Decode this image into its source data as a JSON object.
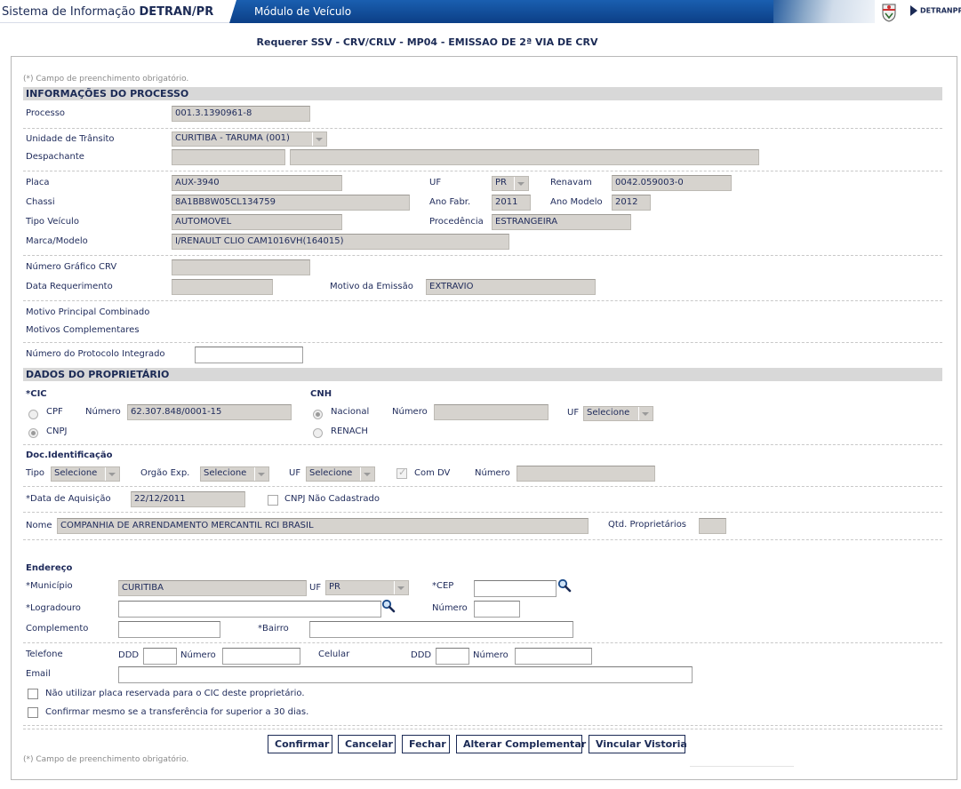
{
  "header": {
    "system_title_prefix": "Sistema de Informação",
    "system_title_brand": "DETRAN/PR",
    "module_title": "Módulo de Veículo",
    "logo_text": "DETRANPR"
  },
  "page_title": "Requerer SSV - CRV/CRLV - MP04 - EMISSAO DE 2ª VIA DE CRV",
  "required_note": "(*) Campo de preenchimento obrigatório.",
  "processo": {
    "section_title": "INFORMAÇÕES DO PROCESSO",
    "processo_label": "Processo",
    "processo_value": "001.3.1390961-8",
    "unidade_label": "Unidade de Trânsito",
    "unidade_value": "CURITIBA - TARUMA (001)",
    "despachante_label": "Despachante",
    "despachante_code": "",
    "despachante_name": "",
    "placa_label": "Placa",
    "placa_value": "AUX-3940",
    "uf_label": "UF",
    "uf_value": "PR",
    "renavam_label": "Renavam",
    "renavam_value": "0042.059003-0",
    "chassi_label": "Chassi",
    "chassi_value": "8A1BB8W05CL134759",
    "ano_fabr_label": "Ano Fabr.",
    "ano_fabr_value": "2011",
    "ano_modelo_label": "Ano Modelo",
    "ano_modelo_value": "2012",
    "tipo_veiculo_label": "Tipo Veículo",
    "tipo_veiculo_value": "AUTOMOVEL",
    "procedencia_label": "Procedência",
    "procedencia_value": "ESTRANGEIRA",
    "marca_label": "Marca/Modelo",
    "marca_value": "I/RENAULT CLIO CAM1016VH(164015)",
    "numero_grafico_label": "Número Gráfico CRV",
    "numero_grafico_value": "",
    "data_req_label": "Data Requerimento",
    "data_req_value": "",
    "motivo_emissao_label": "Motivo da Emissão",
    "motivo_emissao_value": "EXTRAVIO",
    "motivo_principal_label": "Motivo Principal Combinado",
    "motivos_compl_label": "Motivos Complementares",
    "protocolo_label": "Número do Protocolo Integrado",
    "protocolo_value": ""
  },
  "proprietario": {
    "section_title": "DADOS DO PROPRIETÁRIO",
    "cic_label": "*CIC",
    "cpf_label": "CPF",
    "cnpj_label": "CNPJ",
    "numero_label": "Número",
    "cic_numero_value": "62.307.848/0001-15",
    "cnh_label": "CNH",
    "nacional_label": "Nacional",
    "renach_label": "RENACH",
    "cnh_numero_value": "",
    "uf_label": "UF",
    "cnh_uf_value": "Selecione",
    "doc_label": "Doc.Identificação",
    "tipo_label": "Tipo",
    "tipo_value": "Selecione",
    "orgao_label": "Orgão Exp.",
    "orgao_value": "Selecione",
    "doc_uf_value": "Selecione",
    "com_dv_label": "Com DV",
    "doc_numero_value": "",
    "data_aquisicao_label": "*Data de Aquisição",
    "data_aquisicao_value": "22/12/2011",
    "cnpj_nao_cad_label": "CNPJ Não Cadastrado",
    "nome_label": "Nome",
    "nome_value": "COMPANHIA DE ARRENDAMENTO MERCANTIL RCI BRASIL",
    "qtd_label": "Qtd. Proprietários",
    "qtd_value": ""
  },
  "endereco": {
    "title": "Endereço",
    "municipio_label": "*Município",
    "municipio_value": "CURITIBA",
    "uf_label": "UF",
    "uf_value": "PR",
    "cep_label": "*CEP",
    "cep_value": "",
    "logradouro_label": "*Logradouro",
    "logradouro_value": "",
    "numero_label": "Número",
    "numero_value": "",
    "complemento_label": "Complemento",
    "complemento_value": "",
    "bairro_label": "*Bairro",
    "bairro_value": "",
    "telefone_label": "Telefone",
    "ddd_label": "DDD",
    "tel_numero_label": "Número",
    "celular_label": "Celular",
    "email_label": "Email",
    "chk_placa_label": "Não utilizar placa reservada para o CIC deste proprietário.",
    "chk_transf_label": "Confirmar mesmo se a transferência for superior a 30 dias."
  },
  "buttons": {
    "confirmar": "Confirmar",
    "cancelar": "Cancelar",
    "fechar": "Fechar",
    "alterar": "Alterar Complementar",
    "vincular": "Vincular Vistoria"
  },
  "colors": {
    "brand_blue": "#0c3f86",
    "text_navy": "#1b2a55",
    "field_gray": "#d6d3ce"
  },
  "icons": [
    "search-icon",
    "crest-icon",
    "detran-arrow-icon"
  ]
}
